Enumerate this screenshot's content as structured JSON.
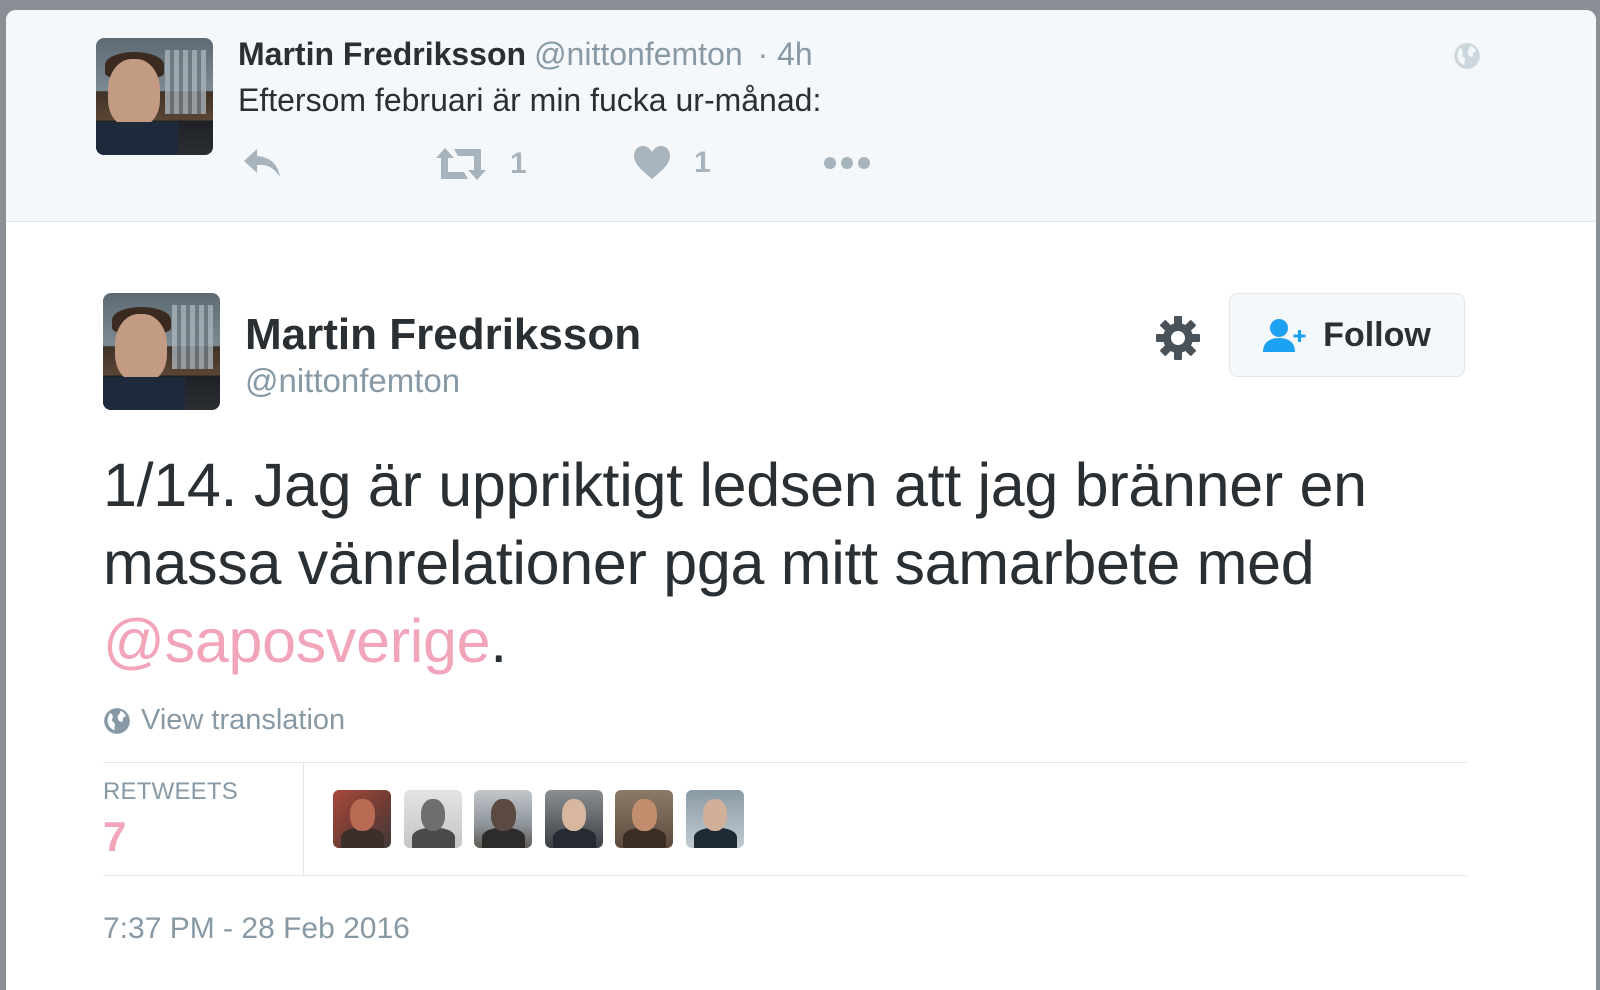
{
  "previous_tweet": {
    "name": "Martin Fredriksson",
    "handle": "@nittonfemton",
    "time": "· 4h",
    "text": "Eftersom februari är min fucka ur-månad:",
    "actions": {
      "reply_icon": "reply-icon",
      "retweet_icon": "retweet-icon",
      "retweet_count": "1",
      "like_icon": "heart-icon",
      "like_count": "1",
      "more_icon": "more-dots-icon"
    },
    "globe_icon": "globe-icon"
  },
  "main_tweet": {
    "name": "Martin Fredriksson",
    "handle": "@nittonfemton",
    "settings_icon": "gear-icon",
    "follow": {
      "icon": "add-user-icon",
      "label": "Follow"
    },
    "text_before_mention": "1/14. Jag är uppriktigt ledsen att jag bränner en massa vänrelationer pga mitt samarbete med ",
    "mention": "@saposverige",
    "text_after_mention": ".",
    "view_translation": "View translation",
    "retweets_label": "RETWEETS",
    "retweets_count": "7",
    "retweeter_avatars": 6,
    "timestamp": "7:37 PM - 28 Feb 2016"
  },
  "colors": {
    "text": "#292f33",
    "muted": "#8899a6",
    "mention": "#f2a5b8",
    "background_prev": "#f5f8fa",
    "follow_icon": "#1da1f2"
  }
}
